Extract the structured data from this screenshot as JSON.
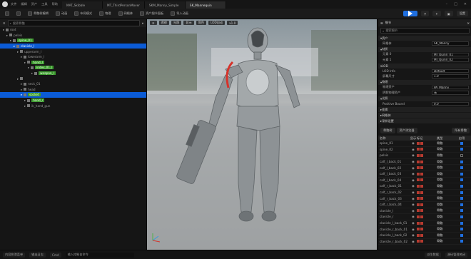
{
  "titlebar": {
    "menus": [
      "文件",
      "编辑",
      "资产",
      "工具",
      "帮助"
    ],
    "tabs": [
      "MAT_Skibble",
      "MT_ThirdPersonMover",
      "SKM_Manny_Simple",
      "SK_Mannequin"
    ],
    "active_tab": 3
  },
  "toolbar": {
    "items": [
      "骨骼树编辑",
      "动画",
      "布局模式",
      "物理",
      "网格体",
      "资产细节面板",
      "导入动画"
    ],
    "right": [
      "设置",
      "帮助"
    ]
  },
  "left_panel": {
    "search_placeholder": "搜索骨骼",
    "rows": [
      {
        "indent": 0,
        "label": "root",
        "chip": "",
        "selected": false
      },
      {
        "indent": 1,
        "label": "pelvis",
        "chip": "",
        "selected": false
      },
      {
        "indent": 2,
        "label": "",
        "chip": "spine_01",
        "selected": false
      },
      {
        "indent": 3,
        "label": "clavicle_l",
        "chip": "",
        "selected": true
      },
      {
        "indent": 4,
        "label": "upperarm_l",
        "chip": "",
        "selected": false
      },
      {
        "indent": 5,
        "label": "lowerarm_l",
        "chip": "",
        "selected": false
      },
      {
        "indent": 6,
        "label": "",
        "chip": "hand_l",
        "selected": false
      },
      {
        "indent": 7,
        "label": "",
        "chip": "index_01_l",
        "selected": false
      },
      {
        "indent": 8,
        "label": "",
        "chip": "weapon_l",
        "selected": false
      },
      {
        "indent": 4,
        "label": "",
        "chip": "",
        "selected": false
      },
      {
        "indent": 5,
        "label": "neck_01",
        "chip": "",
        "selected": false
      },
      {
        "indent": 5,
        "label": "head",
        "chip": "",
        "selected": false
      },
      {
        "indent": 5,
        "label": "",
        "chip": "socket",
        "selected": true
      },
      {
        "indent": 6,
        "label": "",
        "chip": "hand_r",
        "selected": false
      },
      {
        "indent": 6,
        "label": "ik_hand_gun",
        "chip": "",
        "selected": false
      }
    ]
  },
  "viewport": {
    "buttons": [
      "透视",
      "光照",
      "显示",
      "角色",
      "LOD自动",
      "x1.0"
    ],
    "axis_label": "Z Y X"
  },
  "details": {
    "title": "细节",
    "search_placeholder": "搜索细节",
    "sections": [
      {
        "name": "资产",
        "props": [
          {
            "label": "网格体",
            "value": "SK_Manny"
          }
        ]
      },
      {
        "name": "材质",
        "props": [
          {
            "label": "元素 0",
            "value": "MI_Quinn_01"
          },
          {
            "label": "元素 1",
            "value": "MI_Quinn_02"
          }
        ]
      },
      {
        "name": "LOD",
        "props": [
          {
            "label": "LOD Info",
            "value": "Default"
          },
          {
            "label": "屏幕尺寸",
            "value": "1.0"
          }
        ]
      },
      {
        "name": "物理",
        "props": [
          {
            "label": "物理资产",
            "value": "PA_Manny"
          },
          {
            "label": "阴影物理资产",
            "value": "无"
          }
        ]
      },
      {
        "name": "光照",
        "props": [
          {
            "label": "Positive Bound",
            "value": "0.0"
          }
        ]
      }
    ],
    "collapsed": [
      "变换",
      "网格体",
      "采样设置"
    ],
    "asset_tabs": [
      "骨骼树",
      "资产浏览器"
    ],
    "table_filter": "所有骨骼",
    "columns": [
      "名称",
      "显示",
      "标记",
      "类型",
      "启用"
    ],
    "rows": [
      {
        "name": "spine_01",
        "type": "骨骼",
        "on": true
      },
      {
        "name": "spine_02",
        "type": "骨骼",
        "on": true
      },
      {
        "name": "pelvis",
        "type": "骨骼",
        "on": false
      },
      {
        "name": "calf_l_back_01",
        "type": "骨骼",
        "on": true
      },
      {
        "name": "calf_l_back_02",
        "type": "骨骼",
        "on": true
      },
      {
        "name": "calf_l_back_03",
        "type": "骨骼",
        "on": true
      },
      {
        "name": "calf_l_back_04",
        "type": "骨骼",
        "on": true
      },
      {
        "name": "calf_r_back_01",
        "type": "骨骼",
        "on": true
      },
      {
        "name": "calf_r_back_02",
        "type": "骨骼",
        "on": true
      },
      {
        "name": "calf_r_back_03",
        "type": "骨骼",
        "on": true
      },
      {
        "name": "calf_r_back_04",
        "type": "骨骼",
        "on": true
      },
      {
        "name": "clavicle_l",
        "type": "骨骼",
        "on": true
      },
      {
        "name": "clavicle_r",
        "type": "骨骼",
        "on": true
      },
      {
        "name": "clavicle_l_back_01",
        "type": "骨骼",
        "on": true
      },
      {
        "name": "clavicle_r_back_01",
        "type": "骨骼",
        "on": true
      },
      {
        "name": "clavicle_l_back_02",
        "type": "骨骼",
        "on": true
      },
      {
        "name": "clavicle_r_back_02",
        "type": "骨骼",
        "on": true
      }
    ]
  },
  "statusbar": {
    "items": [
      "内容侧滑菜单",
      "输出日志",
      "Cmd",
      "输入控制台命令"
    ],
    "right": [
      "派生数据",
      "源码管理关闭"
    ]
  },
  "colors": {
    "accent": "#1f6fe0",
    "selection": "#0b5bd6",
    "bone_chip": "#3c9a2e",
    "flag": "#b73a2f"
  }
}
